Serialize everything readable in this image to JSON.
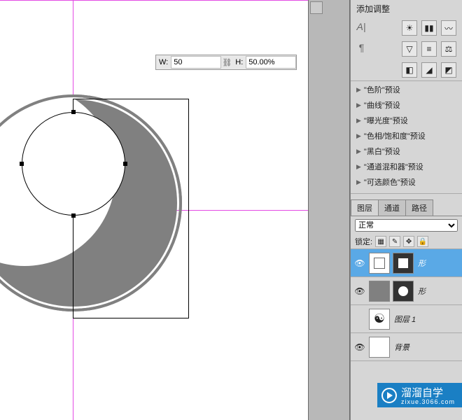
{
  "transform": {
    "w_label": "W:",
    "w_value": "50",
    "h_label": "H:",
    "h_value": "50.00%"
  },
  "adjustments_panel": {
    "title": "添加调整"
  },
  "presets": [
    "\"色阶\"预设",
    "\"曲线\"预设",
    "\"曝光度\"预设",
    "\"色相/饱和度\"预设",
    "\"黑白\"预设",
    "\"通道混和器\"预设",
    "\"可选颜色\"预设"
  ],
  "layer_panel": {
    "tabs": [
      "图层",
      "通道",
      "路径"
    ],
    "blend_mode": "正常",
    "lock_label": "锁定:"
  },
  "layers": [
    {
      "name": "形",
      "type": "shape",
      "selected": true,
      "visible": true
    },
    {
      "name": "形",
      "type": "shape_circle",
      "selected": false,
      "visible": true
    },
    {
      "name": "图层 1",
      "type": "taiji",
      "selected": false,
      "visible": false
    },
    {
      "name": "背景",
      "type": "bg",
      "selected": false,
      "visible": true
    }
  ],
  "watermark": {
    "text": "溜溜自学",
    "url": "zixue.3066.com"
  }
}
